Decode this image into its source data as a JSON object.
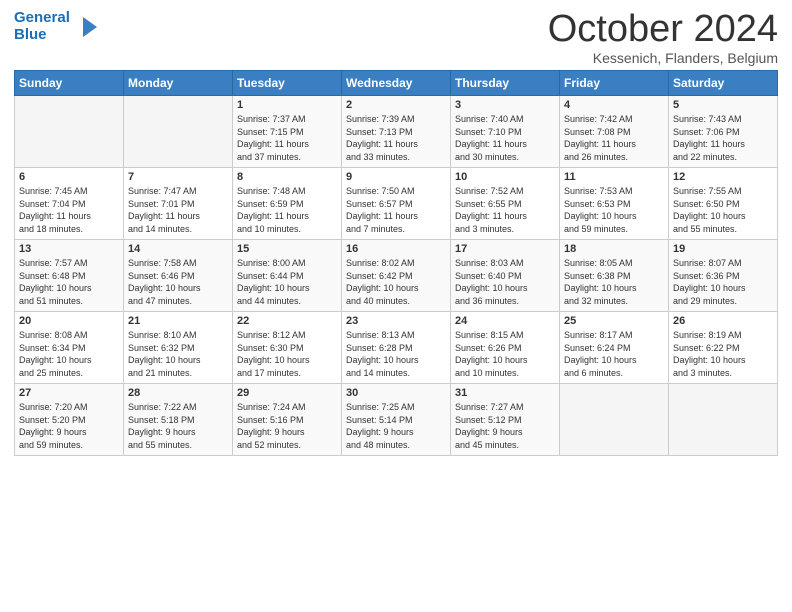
{
  "logo": {
    "line1": "General",
    "line2": "Blue",
    "icon": "▶"
  },
  "title": "October 2024",
  "subtitle": "Kessenich, Flanders, Belgium",
  "days_header": [
    "Sunday",
    "Monday",
    "Tuesday",
    "Wednesday",
    "Thursday",
    "Friday",
    "Saturday"
  ],
  "weeks": [
    [
      {
        "day": "",
        "info": ""
      },
      {
        "day": "",
        "info": ""
      },
      {
        "day": "1",
        "info": "Sunrise: 7:37 AM\nSunset: 7:15 PM\nDaylight: 11 hours\nand 37 minutes."
      },
      {
        "day": "2",
        "info": "Sunrise: 7:39 AM\nSunset: 7:13 PM\nDaylight: 11 hours\nand 33 minutes."
      },
      {
        "day": "3",
        "info": "Sunrise: 7:40 AM\nSunset: 7:10 PM\nDaylight: 11 hours\nand 30 minutes."
      },
      {
        "day": "4",
        "info": "Sunrise: 7:42 AM\nSunset: 7:08 PM\nDaylight: 11 hours\nand 26 minutes."
      },
      {
        "day": "5",
        "info": "Sunrise: 7:43 AM\nSunset: 7:06 PM\nDaylight: 11 hours\nand 22 minutes."
      }
    ],
    [
      {
        "day": "6",
        "info": "Sunrise: 7:45 AM\nSunset: 7:04 PM\nDaylight: 11 hours\nand 18 minutes."
      },
      {
        "day": "7",
        "info": "Sunrise: 7:47 AM\nSunset: 7:01 PM\nDaylight: 11 hours\nand 14 minutes."
      },
      {
        "day": "8",
        "info": "Sunrise: 7:48 AM\nSunset: 6:59 PM\nDaylight: 11 hours\nand 10 minutes."
      },
      {
        "day": "9",
        "info": "Sunrise: 7:50 AM\nSunset: 6:57 PM\nDaylight: 11 hours\nand 7 minutes."
      },
      {
        "day": "10",
        "info": "Sunrise: 7:52 AM\nSunset: 6:55 PM\nDaylight: 11 hours\nand 3 minutes."
      },
      {
        "day": "11",
        "info": "Sunrise: 7:53 AM\nSunset: 6:53 PM\nDaylight: 10 hours\nand 59 minutes."
      },
      {
        "day": "12",
        "info": "Sunrise: 7:55 AM\nSunset: 6:50 PM\nDaylight: 10 hours\nand 55 minutes."
      }
    ],
    [
      {
        "day": "13",
        "info": "Sunrise: 7:57 AM\nSunset: 6:48 PM\nDaylight: 10 hours\nand 51 minutes."
      },
      {
        "day": "14",
        "info": "Sunrise: 7:58 AM\nSunset: 6:46 PM\nDaylight: 10 hours\nand 47 minutes."
      },
      {
        "day": "15",
        "info": "Sunrise: 8:00 AM\nSunset: 6:44 PM\nDaylight: 10 hours\nand 44 minutes."
      },
      {
        "day": "16",
        "info": "Sunrise: 8:02 AM\nSunset: 6:42 PM\nDaylight: 10 hours\nand 40 minutes."
      },
      {
        "day": "17",
        "info": "Sunrise: 8:03 AM\nSunset: 6:40 PM\nDaylight: 10 hours\nand 36 minutes."
      },
      {
        "day": "18",
        "info": "Sunrise: 8:05 AM\nSunset: 6:38 PM\nDaylight: 10 hours\nand 32 minutes."
      },
      {
        "day": "19",
        "info": "Sunrise: 8:07 AM\nSunset: 6:36 PM\nDaylight: 10 hours\nand 29 minutes."
      }
    ],
    [
      {
        "day": "20",
        "info": "Sunrise: 8:08 AM\nSunset: 6:34 PM\nDaylight: 10 hours\nand 25 minutes."
      },
      {
        "day": "21",
        "info": "Sunrise: 8:10 AM\nSunset: 6:32 PM\nDaylight: 10 hours\nand 21 minutes."
      },
      {
        "day": "22",
        "info": "Sunrise: 8:12 AM\nSunset: 6:30 PM\nDaylight: 10 hours\nand 17 minutes."
      },
      {
        "day": "23",
        "info": "Sunrise: 8:13 AM\nSunset: 6:28 PM\nDaylight: 10 hours\nand 14 minutes."
      },
      {
        "day": "24",
        "info": "Sunrise: 8:15 AM\nSunset: 6:26 PM\nDaylight: 10 hours\nand 10 minutes."
      },
      {
        "day": "25",
        "info": "Sunrise: 8:17 AM\nSunset: 6:24 PM\nDaylight: 10 hours\nand 6 minutes."
      },
      {
        "day": "26",
        "info": "Sunrise: 8:19 AM\nSunset: 6:22 PM\nDaylight: 10 hours\nand 3 minutes."
      }
    ],
    [
      {
        "day": "27",
        "info": "Sunrise: 7:20 AM\nSunset: 5:20 PM\nDaylight: 9 hours\nand 59 minutes."
      },
      {
        "day": "28",
        "info": "Sunrise: 7:22 AM\nSunset: 5:18 PM\nDaylight: 9 hours\nand 55 minutes."
      },
      {
        "day": "29",
        "info": "Sunrise: 7:24 AM\nSunset: 5:16 PM\nDaylight: 9 hours\nand 52 minutes."
      },
      {
        "day": "30",
        "info": "Sunrise: 7:25 AM\nSunset: 5:14 PM\nDaylight: 9 hours\nand 48 minutes."
      },
      {
        "day": "31",
        "info": "Sunrise: 7:27 AM\nSunset: 5:12 PM\nDaylight: 9 hours\nand 45 minutes."
      },
      {
        "day": "",
        "info": ""
      },
      {
        "day": "",
        "info": ""
      }
    ]
  ]
}
